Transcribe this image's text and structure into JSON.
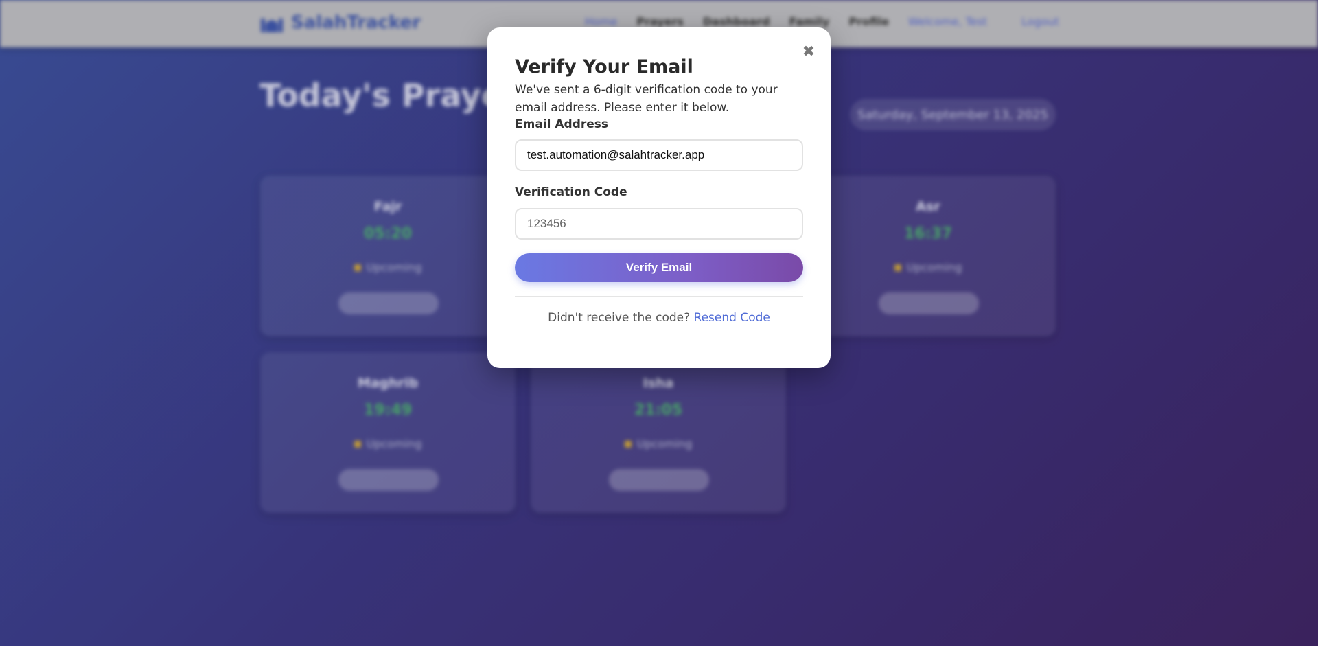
{
  "navbar": {
    "brand": "SalahTracker",
    "links": [
      "Home",
      "Prayers",
      "Dashboard",
      "Family",
      "Profile"
    ],
    "welcome": "Welcome, Test",
    "logout": "Logout"
  },
  "page": {
    "title": "Today's Prayers",
    "date": "Saturday, September 13, 2025"
  },
  "prayers": [
    {
      "name": "Fajr",
      "time": "05:20",
      "status": "Upcoming"
    },
    {
      "name": "Asr",
      "time": "16:37",
      "status": "Upcoming"
    },
    {
      "name": "Maghrib",
      "time": "19:49",
      "status": "Upcoming"
    },
    {
      "name": "Isha",
      "time": "21:05",
      "status": "Upcoming"
    }
  ],
  "modal": {
    "title": "Verify Your Email",
    "description": "We've sent a 6-digit verification code to your email address. Please enter it below.",
    "email_label": "Email Address",
    "email_value": "test.automation@salahtracker.app",
    "code_label": "Verification Code",
    "code_value": "123456",
    "verify_button": "Verify Email",
    "resend_prompt": "Didn't receive the code?",
    "resend_link": "Resend Code",
    "close_symbol": "✖"
  }
}
